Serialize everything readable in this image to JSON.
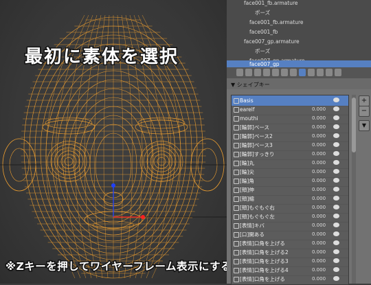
{
  "captions": {
    "top": "最初に素体を選択",
    "bottom": "※Zキーを押してワイヤーフレーム表示にするとわかりやすい"
  },
  "outliner": {
    "rows": [
      {
        "label": "face001_fb.armature",
        "type": "armature"
      },
      {
        "label": "ポーズ",
        "type": "pose"
      },
      {
        "label": "face001_fb.armature",
        "type": "armature"
      },
      {
        "label": "face001_fb",
        "type": "mesh"
      },
      {
        "label": "face007_gp.armature",
        "type": "armature"
      },
      {
        "label": "ポーズ",
        "type": "pose"
      },
      {
        "label": "face007_gp.armature",
        "type": "armature"
      },
      {
        "label": "face007_gp",
        "type": "mesh",
        "selected": true
      }
    ]
  },
  "panel": {
    "section_title": "▼ シェイプキー"
  },
  "shape_keys": [
    {
      "name": "Basis",
      "value": "",
      "selected": true
    },
    {
      "name": "earelf",
      "value": "0.000"
    },
    {
      "name": "mouthi",
      "value": "0.000"
    },
    {
      "name": "[輪郭]ベース",
      "value": "0.000"
    },
    {
      "name": "[輪郭]ベース2",
      "value": "0.000"
    },
    {
      "name": "[輪郭]ベース3",
      "value": "0.000"
    },
    {
      "name": "[輪郭]すっきり",
      "value": "0.000"
    },
    {
      "name": "[輪]丸",
      "value": "0.000"
    },
    {
      "name": "[輪]尖",
      "value": "0.000"
    },
    {
      "name": "[輪]角",
      "value": "0.000"
    },
    {
      "name": "[頬]伸",
      "value": "0.000"
    },
    {
      "name": "[頬]縮",
      "value": "0.000"
    },
    {
      "name": "[頬]もぐもぐ右",
      "value": "0.000"
    },
    {
      "name": "[頬]もぐもぐ左",
      "value": "0.000"
    },
    {
      "name": "[表情]キバ",
      "value": "0.000"
    },
    {
      "name": "[口]開ある",
      "value": "0.000"
    },
    {
      "name": "[表情]口角を上げる",
      "value": "0.000"
    },
    {
      "name": "[表情]口角を上げる2",
      "value": "0.000"
    },
    {
      "name": "[表情]口角を上げる3",
      "value": "0.000"
    },
    {
      "name": "[表情]口角を上げる4",
      "value": "0.000"
    },
    {
      "name": "[表情]口角を上げる",
      "value": "0.000"
    }
  ],
  "side_buttons": [
    "+",
    "−",
    "▼"
  ],
  "colors": {
    "wire": "#f0a030",
    "selected": "#5680c2"
  }
}
